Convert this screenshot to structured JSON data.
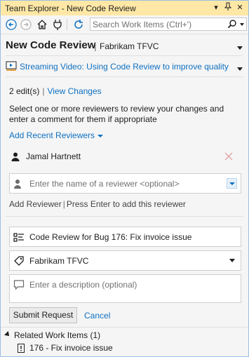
{
  "window": {
    "title": "Team Explorer - New Code Review",
    "controls": {
      "dropdown": "▾",
      "pin": "⊤",
      "close": "✕"
    }
  },
  "toolbar": {
    "search_placeholder": "Search Work Items (Ctrl+')"
  },
  "header": {
    "title": "New Code Review",
    "separator": "|",
    "context": "Fabrikam TFVC"
  },
  "video_link": "Streaming Video: Using Code Review to improve quality",
  "changes": {
    "edits": "2 edit(s)",
    "separator": "|",
    "view_changes": "View Changes"
  },
  "instructions": "Select one or more reviewers to review your changes and enter a comment for them if appropriate",
  "add_recent_reviewers": "Add Recent Reviewers",
  "reviewers": [
    {
      "name": "Jamal Hartnett"
    }
  ],
  "reviewer_input": {
    "placeholder": "Enter the name of a reviewer <optional>"
  },
  "add_reviewer_hint": {
    "label": "Add Reviewer",
    "separator": "|",
    "hint": "Press Enter to add this reviewer"
  },
  "review_title": {
    "value": "Code Review for Bug 176: Fix invoice issue"
  },
  "project": {
    "value": "Fabrikam TFVC"
  },
  "description": {
    "placeholder": "Enter a description (optional)"
  },
  "actions": {
    "submit": "Submit Request",
    "cancel": "Cancel"
  },
  "related_work_items": {
    "title": "Related Work Items (1)",
    "items": [
      {
        "label": "176 - Fix invoice issue"
      }
    ]
  },
  "colors": {
    "title_bar": "#ffe8a6",
    "link": "#0e70c0",
    "frame_border": "#9bbde6"
  }
}
